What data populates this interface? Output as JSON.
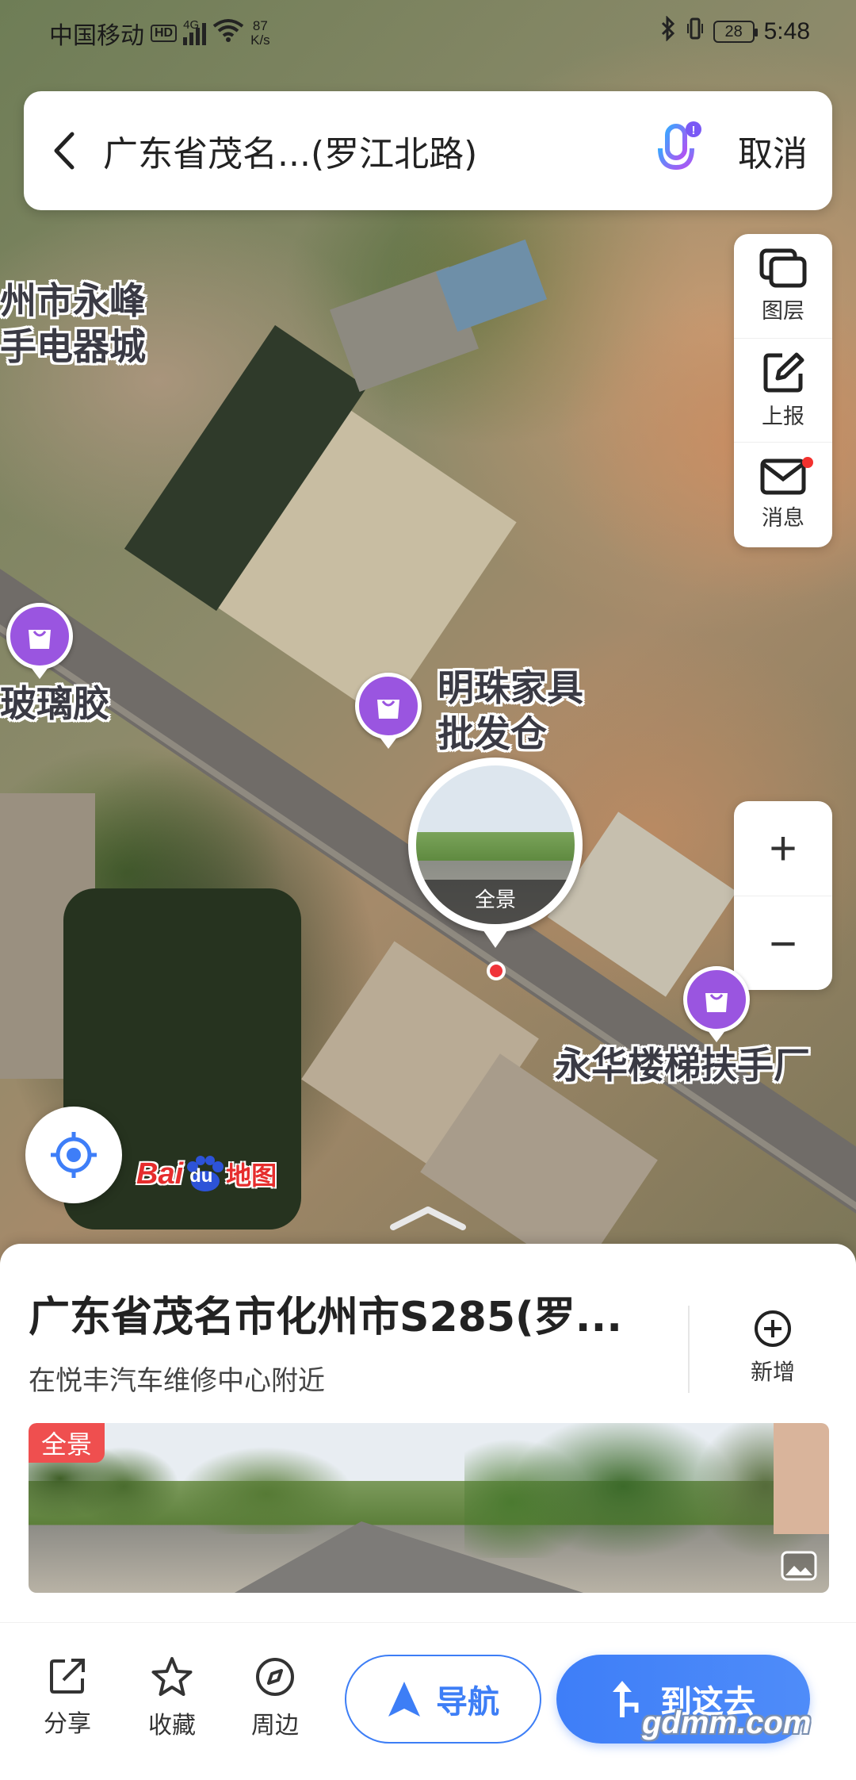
{
  "status_bar": {
    "carrier": "中国移动",
    "hd": "HD",
    "network": "4G",
    "speed_value": "87",
    "speed_unit": "K/s",
    "battery": "28",
    "time": "5:48"
  },
  "search": {
    "query": "广东省茂名...(罗江北路)",
    "cancel_label": "取消"
  },
  "tools": {
    "layers_label": "图层",
    "report_label": "上报",
    "messages_label": "消息"
  },
  "zoom": {
    "in_label": "+",
    "out_label": "−"
  },
  "map_labels": {
    "label_a_line1": "州市永峰",
    "label_a_line2": "手电器城",
    "label_b": "玻璃胶",
    "label_c_line1": "明珠家具",
    "label_c_line2": "批发仓",
    "label_d": "永华楼梯扶手厂"
  },
  "pano_pin": {
    "tag": "全景"
  },
  "logo": {
    "text_a": "Bai",
    "text_du": "du",
    "text_map": "地图"
  },
  "place": {
    "title": "广东省茂名市化州市S285(罗...",
    "subtitle": "在悦丰汽车维修中心附近",
    "add_label": "新增",
    "pano_tag": "全景"
  },
  "actions": {
    "share_label": "分享",
    "favorite_label": "收藏",
    "nearby_label": "周边",
    "navigate_label": "导航",
    "go_label": "到这去"
  },
  "watermark": "gdmm.com",
  "colors": {
    "accent": "#3e7ef8",
    "poi": "#9a55e0",
    "danger": "#f0343a"
  }
}
